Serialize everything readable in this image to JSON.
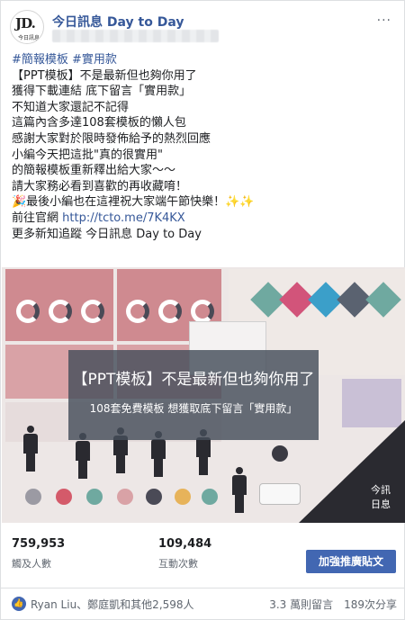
{
  "header": {
    "page_name": "今日訊息 Day to Day",
    "avatar_letters": "JD.",
    "avatar_sub": "今日訊息",
    "more_label": "···"
  },
  "post": {
    "hashtags": "#簡報模板 #實用款",
    "lines": [
      "【PPT模板】不是最新但也夠你用了",
      "獲得下載連結 底下留言「實用款」",
      "不知道大家還記不記得",
      "這篇內含多達108套模板的懶人包",
      "感謝大家對於限時發佈給予的熱烈回應",
      "小編今天把這批\"真的很實用\"",
      "的簡報模板重新釋出給大家～～",
      "請大家務必看到喜歡的再收藏唷！",
      "🎉最後小編也在這裡祝大家端午節快樂！✨✨",
      "前往官網 ",
      "更多新知追蹤 今日訊息 Day to Day"
    ],
    "link_text": "http://tcto.me/7K4KX"
  },
  "image": {
    "overlay_title": "【PPT模板】不是最新但也夠你用了",
    "overlay_subtitle": "108套免費模板  想獲取底下留言「實用款」",
    "watermark_top": "今訊",
    "watermark_bottom": "日息"
  },
  "stats": {
    "reach_value": "759,953",
    "reach_label": "觸及人數",
    "engagement_value": "109,484",
    "engagement_label": "互動次數",
    "boost_label": "加強推廣貼文"
  },
  "footer": {
    "like_icon": "like-thumb-icon",
    "reactors": "Ryan Liu、鄭庭凱和其他2,598人",
    "comments": "3.3 萬則留言",
    "shares": "189次分享"
  },
  "colors": {
    "link": "#365899",
    "boost_button": "#4267b2",
    "slide_pink": "#cf8a90",
    "banner": "#464e5a"
  }
}
